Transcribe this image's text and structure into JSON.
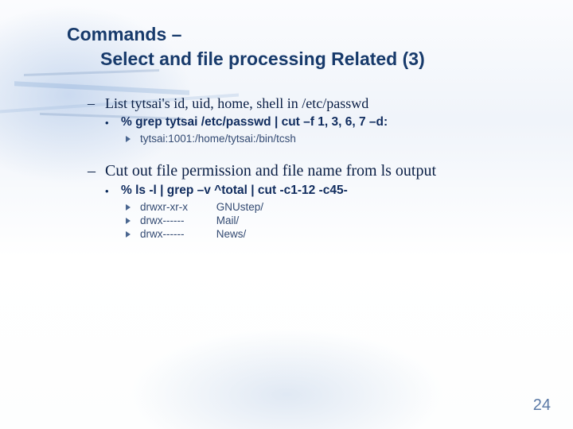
{
  "title": {
    "line1": "Commands –",
    "line2": "Select and file processing Related (3)"
  },
  "sections": [
    {
      "heading": "List tytsai's id, uid, home, shell in /etc/passwd",
      "command": "% grep tytsai /etc/passwd | cut –f 1, 3, 6, 7 –d:",
      "output": [
        "tytsai:1001:/home/tytsai:/bin/tcsh"
      ]
    },
    {
      "heading": "Cut out file permission and file name from ls output",
      "command": "% ls -l | grep –v ^total | cut -c1-12 -c45-",
      "output_rows": [
        {
          "perm": "drwxr-xr-x",
          "name": "GNUstep/"
        },
        {
          "perm": "drwx------",
          "name": "Mail/"
        },
        {
          "perm": "drwx------",
          "name": "News/"
        }
      ]
    }
  ],
  "page_number": "24"
}
